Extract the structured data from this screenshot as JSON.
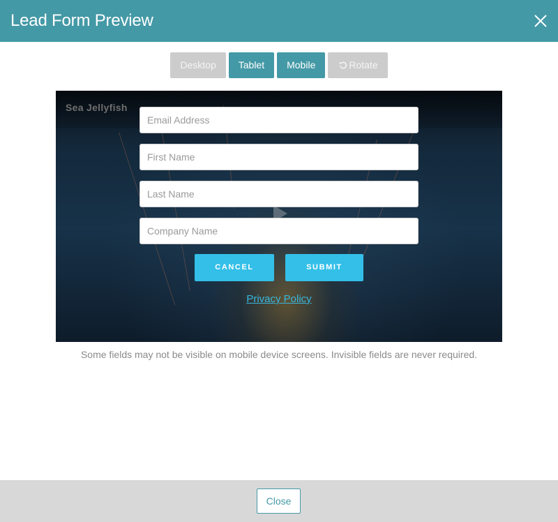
{
  "header": {
    "title": "Lead Form Preview",
    "close_icon": "close-icon"
  },
  "device_toggle": {
    "desktop_label": "Desktop",
    "tablet_label": "Tablet",
    "mobile_label": "Mobile",
    "rotate_label": "Rotate",
    "rotate_icon": "rotate-icon",
    "selected": [
      "Tablet",
      "Mobile"
    ]
  },
  "preview": {
    "video_title": "Sea Jellyfish",
    "play_icon": "play-icon",
    "form": {
      "email_placeholder": "Email Address",
      "first_name_placeholder": "First Name",
      "last_name_placeholder": "Last Name",
      "company_placeholder": "Company Name",
      "cancel_label": "CANCEL",
      "submit_label": "SUBMIT",
      "privacy_label": "Privacy Policy"
    }
  },
  "notice": "Some fields may not be visible on mobile device screens. Invisible fields are never required.",
  "footer": {
    "close_label": "Close"
  },
  "colors": {
    "header_teal": "#4499a6",
    "form_button_blue": "#33bfe8",
    "inactive_gray": "#cccccc",
    "footer_gray": "#d8d8d8"
  }
}
